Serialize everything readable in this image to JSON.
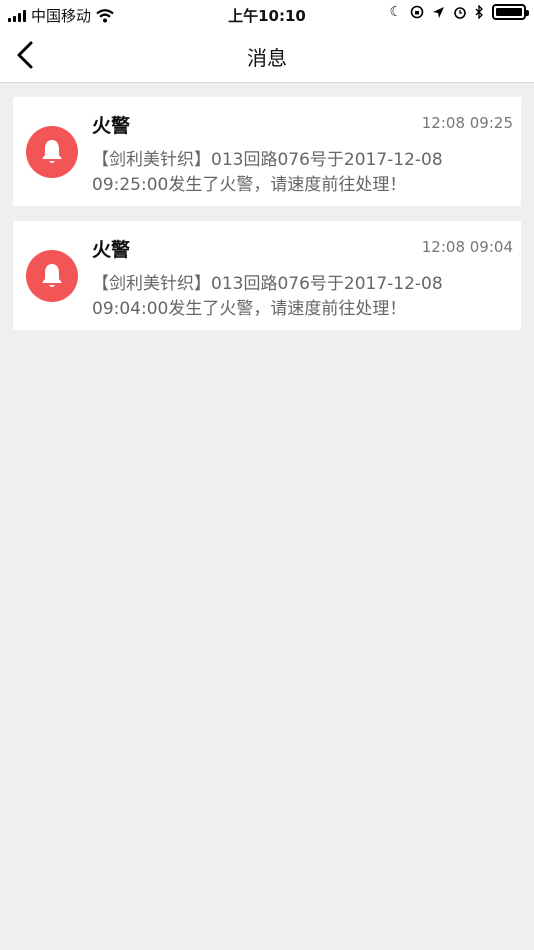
{
  "status_bar": {
    "carrier": "中国移动",
    "time": "上午10:10"
  },
  "nav": {
    "title": "消息"
  },
  "messages": [
    {
      "title": "火警",
      "time": "12:08 09:25",
      "body": "【剑利美针织】013回路076号于2017-12-08 09:25:00发生了火警，请速度前往处理！",
      "icon": "bell-icon"
    },
    {
      "title": "火警",
      "time": "12:08 09:04",
      "body": "【剑利美针织】013回路076号于2017-12-08 09:04:00发生了火警，请速度前往处理！",
      "icon": "bell-icon"
    }
  ],
  "colors": {
    "alert_red": "#f25555",
    "background": "#efefef"
  }
}
